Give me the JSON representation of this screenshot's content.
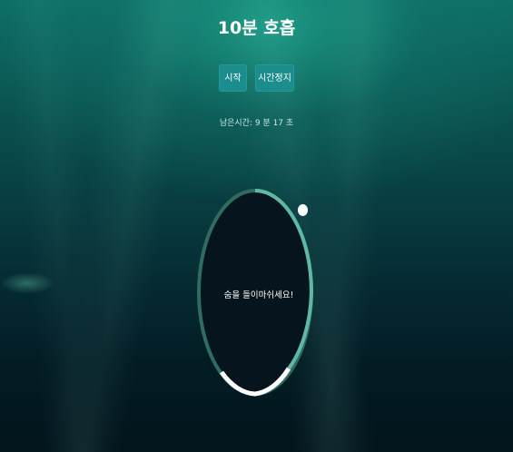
{
  "title": "10분 호흡",
  "controls": {
    "start_label": "시작",
    "stop_label": "시간정지"
  },
  "timer": {
    "remaining_text": "남은시간: 9 분 17 초"
  },
  "breath": {
    "instruction": "숨을 들이마쉬세요!"
  },
  "colors": {
    "button": "#1b8d8d",
    "ring_track": "#2f6b5f",
    "ring_progress": "#5fb8a4",
    "ring_highlight": "#ffffff",
    "circle_fill": "#05141d"
  }
}
